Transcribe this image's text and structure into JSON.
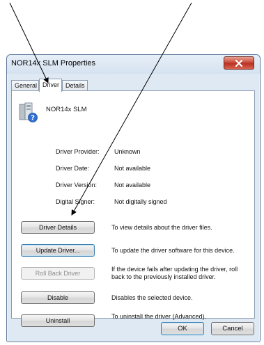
{
  "window": {
    "title": "NOR14x SLM Properties",
    "close_icon": "close-icon"
  },
  "tabs": [
    {
      "label": "General"
    },
    {
      "label": "Driver",
      "active": true
    },
    {
      "label": "Details"
    }
  ],
  "device": {
    "name": "NOR14x SLM",
    "icon": "device-unknown-icon"
  },
  "properties": [
    {
      "label": "Driver Provider:",
      "value": "Unknown"
    },
    {
      "label": "Driver Date:",
      "value": "Not available"
    },
    {
      "label": "Driver Version:",
      "value": "Not available"
    },
    {
      "label": "Digital Signer:",
      "value": "Not digitally signed"
    }
  ],
  "actions": [
    {
      "button": "Driver Details",
      "description": "To view details about the driver files."
    },
    {
      "button": "Update Driver...",
      "description": "To update the driver software for this device."
    },
    {
      "button": "Roll Back Driver",
      "description": "If the device fails after updating the driver, roll back to the previously installed driver.",
      "disabled": true
    },
    {
      "button": "Disable",
      "description": "Disables the selected device."
    },
    {
      "button": "Uninstall",
      "description": "To uninstall the driver (Advanced)."
    }
  ],
  "footer": {
    "ok_label": "OK",
    "cancel_label": "Cancel"
  },
  "colors": {
    "close_button": "#c8483a",
    "titlebar": "#dfe9f4",
    "arrow": "#000000"
  }
}
